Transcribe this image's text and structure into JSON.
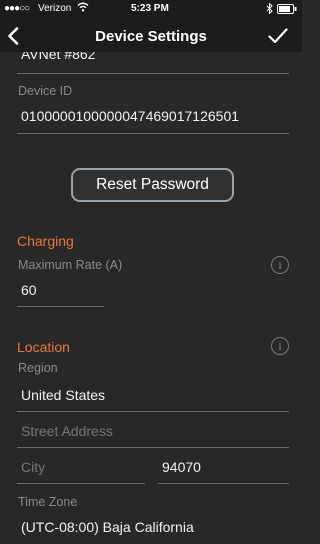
{
  "status": {
    "carrier": "Verizon",
    "time": "5:23 PM"
  },
  "nav": {
    "title": "Device Settings",
    "back_icon": "chevron-left-icon",
    "done_icon": "checkmark-icon"
  },
  "device": {
    "name_partial": "AVNet #862",
    "id_label": "Device ID",
    "id_value": "0100000100000047469017126501"
  },
  "reset_button": "Reset Password",
  "charging": {
    "header": "Charging",
    "max_rate_label": "Maximum Rate (A)",
    "max_rate_value": "60"
  },
  "location": {
    "header": "Location",
    "region_label": "Region",
    "region_value": "United States",
    "street_placeholder": "Street Address",
    "city_placeholder": "City",
    "zip_value": "94070",
    "timezone_label": "Time Zone",
    "timezone_value": "(UTC-08:00) Baja California"
  },
  "colors": {
    "accent": "#e8773a",
    "background": "#282828",
    "bar": "#1c1c1c"
  }
}
